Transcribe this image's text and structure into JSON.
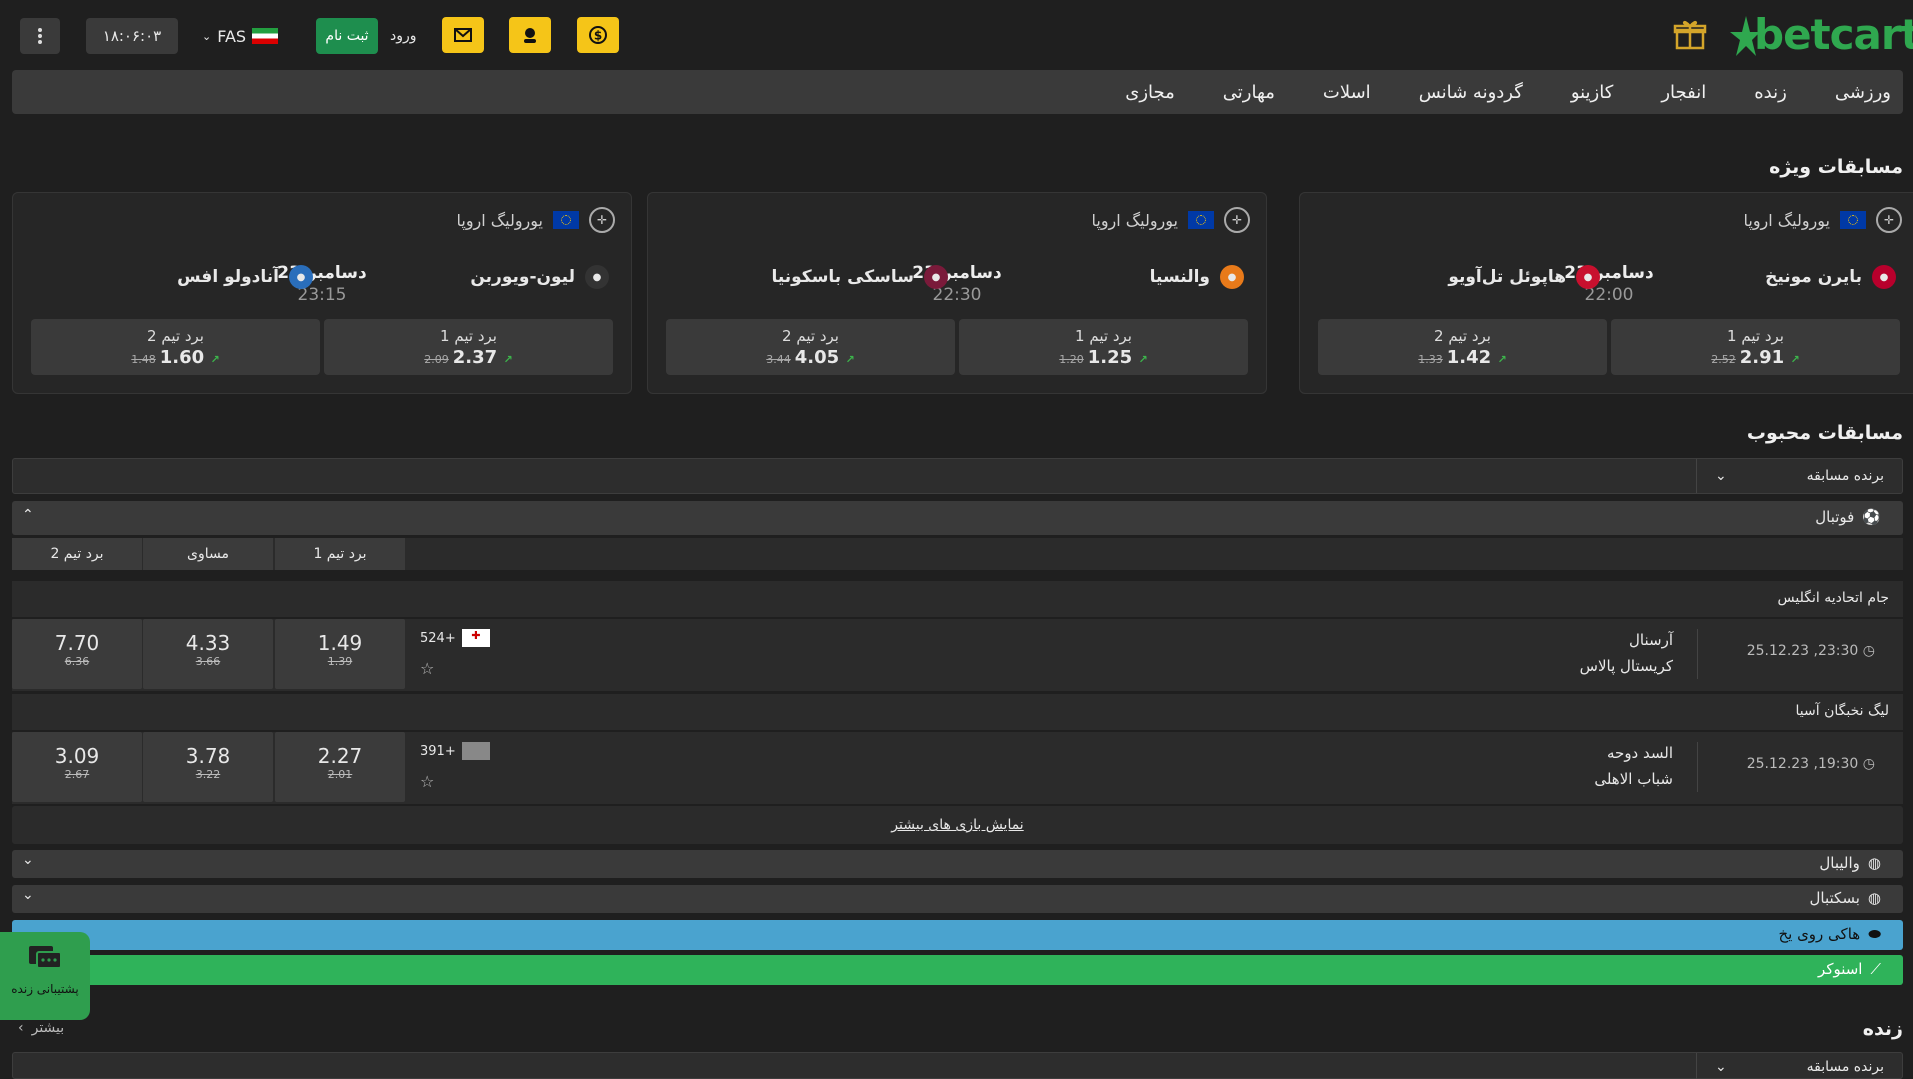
{
  "header": {
    "brand": "betcart",
    "clock": "۱۸:۰۶:۰۳",
    "lang": "FAS",
    "register": "ثبت نام",
    "login": "ورود"
  },
  "nav": [
    "ورزشی",
    "زنده",
    "انفجار",
    "کازینو",
    "گردونه شانس",
    "اسلات",
    "مهارتی",
    "مجازی"
  ],
  "featured": {
    "title": "مسابقات ویژه",
    "cards": [
      {
        "league": "یورولیگ اروپا",
        "team1": "بایرن مونیخ",
        "team2": "هاپوئل تل‌آویو",
        "date": "دسامبر 23",
        "time": "22:00",
        "o1_label": "برد تیم 1",
        "o1": "2.91",
        "o1_old": "2.52",
        "o2_label": "برد تیم 2",
        "o2": "1.42",
        "o2_old": "1.33"
      },
      {
        "league": "یورولیگ اروپا",
        "team1": "والنسیا",
        "team2": "ساسکی باسکونیا",
        "date": "دسامبر 23",
        "time": "22:30",
        "o1_label": "برد تیم 1",
        "o1": "1.25",
        "o1_old": "1.20",
        "o2_label": "برد تیم 2",
        "o2": "4.05",
        "o2_old": "3.44"
      },
      {
        "league": "یورولیگ اروپا",
        "team1": "لیون-ویوربن",
        "team2": "آنادولو افس",
        "date": "دسامبر 23",
        "time": "23:15",
        "o1_label": "برد تیم 1",
        "o1": "2.37",
        "o1_old": "2.09",
        "o2_label": "برد تیم 2",
        "o2": "1.60",
        "o2_old": "1.48"
      }
    ]
  },
  "popular": {
    "title": "مسابقات محبوب",
    "market": "برنده مسابقه",
    "football": "فوتبال",
    "cols": {
      "c1": "برد تیم 1",
      "cx": "مساوی",
      "c2": "برد تیم 2"
    },
    "leagues": [
      {
        "name": "جام اتحادیه انگلیس",
        "datetime": "25.12.23 ,23:30",
        "home": "آرسنال",
        "away": "کریستال پالاس",
        "more": "524+",
        "o1": "1.49",
        "o1_old": "1.39",
        "ox": "4.33",
        "ox_old": "3.66",
        "o2": "7.70",
        "o2_old": "6.36"
      },
      {
        "name": "لیگ نخبگان آسیا",
        "datetime": "25.12.23 ,19:30",
        "home": "السد دوحه",
        "away": "شباب الاهلی",
        "more": "391+",
        "o1": "2.27",
        "o1_old": "2.01",
        "ox": "3.78",
        "ox_old": "3.22",
        "o2": "3.09",
        "o2_old": "2.67"
      }
    ],
    "show_more": "نمایش بازی های بیشتر",
    "sports": [
      "والیبال",
      "بسکتبال",
      "هاکی روی یخ",
      "اسنوکر"
    ]
  },
  "live": {
    "title": "زنده",
    "more": "بیشتر",
    "market": "برنده مسابقه"
  },
  "support": "پشتیبانی زنده",
  "colors": {
    "accent": "#f5c518",
    "green": "#3cb44b",
    "hockey": "#4aa3cf",
    "snooker": "#2fb35a"
  }
}
